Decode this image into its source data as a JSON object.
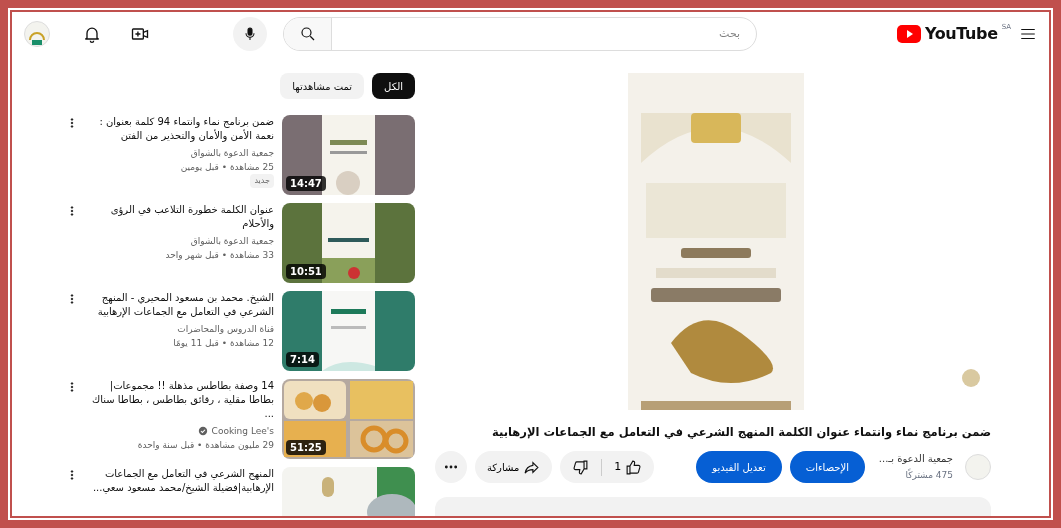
{
  "header": {
    "logo_text": "YouTube",
    "country": "SA",
    "search_placeholder": "بحث"
  },
  "video": {
    "kind": "picture",
    "title": "ضمن برنامج نماء وانتماء عنوان الكلمة المنهج الشرعي في التعامل مع الجماعات الإرهابية",
    "channel": {
      "name": "جمعية الدعوة بـ...",
      "subscribers": "475 مشتركًا"
    },
    "buttons": [
      "الإحصاءات",
      "تعديل الفيديو"
    ],
    "likes": "1",
    "share": "مشاركة"
  },
  "sidebar": {
    "chips": [
      {
        "label": "الكل",
        "selected": true
      },
      {
        "label": "تمت مشاهدتها",
        "selected": false
      }
    ],
    "items": [
      {
        "title": "ضمن برنامج نماء وانتماء 94 كلمة بعنوان : نعمة الأمن والأمان والتحذير من الفتن",
        "channel": "جمعية الدعوة بالشواق",
        "verified": false,
        "meta": "25 مشاهدة • قبل يومين",
        "badge": "جديد",
        "duration": "14:47"
      },
      {
        "title": "عنوان الكلمة خطورة التلاعب في الرؤى والأحلام",
        "channel": "جمعية الدعوة بالشواق",
        "verified": false,
        "meta": "33 مشاهدة • قبل شهر واحد",
        "duration": "10:51"
      },
      {
        "title": "الشيخ. محمد بن مسعود المحيري - المنهج الشرعي في التعامل مع الجماعات الإرهابية",
        "channel": "قناة الدروس والمحاضرات",
        "verified": false,
        "meta": "12 مشاهدة • قبل 11 يومًا",
        "duration": "7:14"
      },
      {
        "title": "14 وصفة بطاطس مذهلة !! مجموعات| بطاطا مقلية ، رقائق بطاطس ، بطاطا سناك ...",
        "channel": "Cooking Lee's",
        "verified": true,
        "meta": "29 مليون مشاهدة • قبل سنة واحدة",
        "duration": "51:25"
      },
      {
        "title": "المنهج الشرعي في التعامل مع الجماعات الإرهابية|فضيلة الشيخ/محمد مسعود سعي..."
      }
    ]
  }
}
